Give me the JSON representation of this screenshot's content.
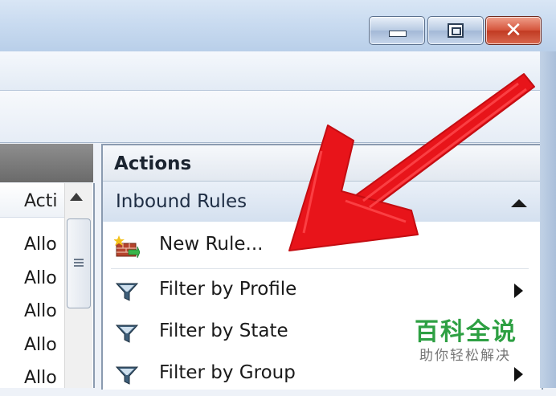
{
  "window": {
    "controls": {
      "minimize_icon": "minimize-icon",
      "maximize_icon": "restore-icon",
      "close_glyph": "✕"
    }
  },
  "left_pane": {
    "column_header": "Acti",
    "rows": [
      "Allo",
      "Allo",
      "Allo",
      "Allo",
      "Allo"
    ]
  },
  "actions": {
    "header": "Actions",
    "section": {
      "title": "Inbound Rules",
      "items": [
        {
          "label": "New Rule...",
          "icon": "new-rule-icon",
          "has_submenu": false
        },
        {
          "label": "Filter by Profile",
          "icon": "filter-icon",
          "has_submenu": true
        },
        {
          "label": "Filter by State",
          "icon": "filter-icon",
          "has_submenu": false
        },
        {
          "label": "Filter by Group",
          "icon": "filter-icon",
          "has_submenu": true
        }
      ]
    }
  },
  "watermark": {
    "main": "百科全说",
    "sub": "助你轻松解决"
  },
  "colors": {
    "arrow": "#e8141a",
    "watermark": "#2ea043"
  }
}
